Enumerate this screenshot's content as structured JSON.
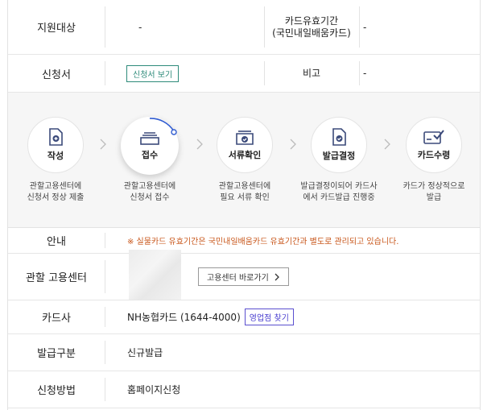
{
  "rows": {
    "target": {
      "label": "지원대상",
      "value": "-"
    },
    "card_validity": {
      "label_line1": "카드유효기간",
      "label_line2": "(국민내일배움카드)",
      "value": "-"
    },
    "application": {
      "label": "신청서",
      "button": "신청서 보기"
    },
    "remarks": {
      "label": "비고",
      "value": "-"
    }
  },
  "process": {
    "steps": [
      {
        "label": "작성",
        "desc_line1": "관할고용센터에",
        "desc_line2": "신청서 정상 제출",
        "icon": "document-plus-icon"
      },
      {
        "label": "접수",
        "desc_line1": "관할고용센터에",
        "desc_line2": "신청서 접수",
        "icon": "stack-icon",
        "active": true
      },
      {
        "label": "서류확인",
        "desc_line1": "관할고용센터에",
        "desc_line2": "필요 서류 확인",
        "icon": "inbox-check-icon"
      },
      {
        "label": "발급결정",
        "desc_line1": "발급결정이되어 카드사",
        "desc_line2": "에서 카드발급 진행중",
        "icon": "document-check-icon"
      },
      {
        "label": "카드수령",
        "desc_line1": "카드가 정상적으로",
        "desc_line2": "발급",
        "icon": "card-check-icon"
      }
    ]
  },
  "info": {
    "notice": {
      "label": "안내",
      "text": "※ 실물카드 유효기간은 국민내일배움카드 유효기간과 별도로 관리되고 있습니다."
    },
    "center": {
      "label": "관할 고용센터",
      "button": "고용센터 바로가기"
    },
    "card_company": {
      "label": "카드사",
      "value": "NH농협카드 (1644-4000)",
      "button": "영업점 찾기"
    },
    "issue_type": {
      "label": "발급구분",
      "value": "신규발급"
    },
    "apply_method": {
      "label": "신청방법",
      "value": "홈페이지신청"
    }
  },
  "colors": {
    "accent_green": "#2e8b7a",
    "notice_orange": "#c8561a",
    "purple": "#4a3fcf",
    "icon_navy": "#3b4a7a",
    "progress_blue": "#2f5bd0"
  }
}
